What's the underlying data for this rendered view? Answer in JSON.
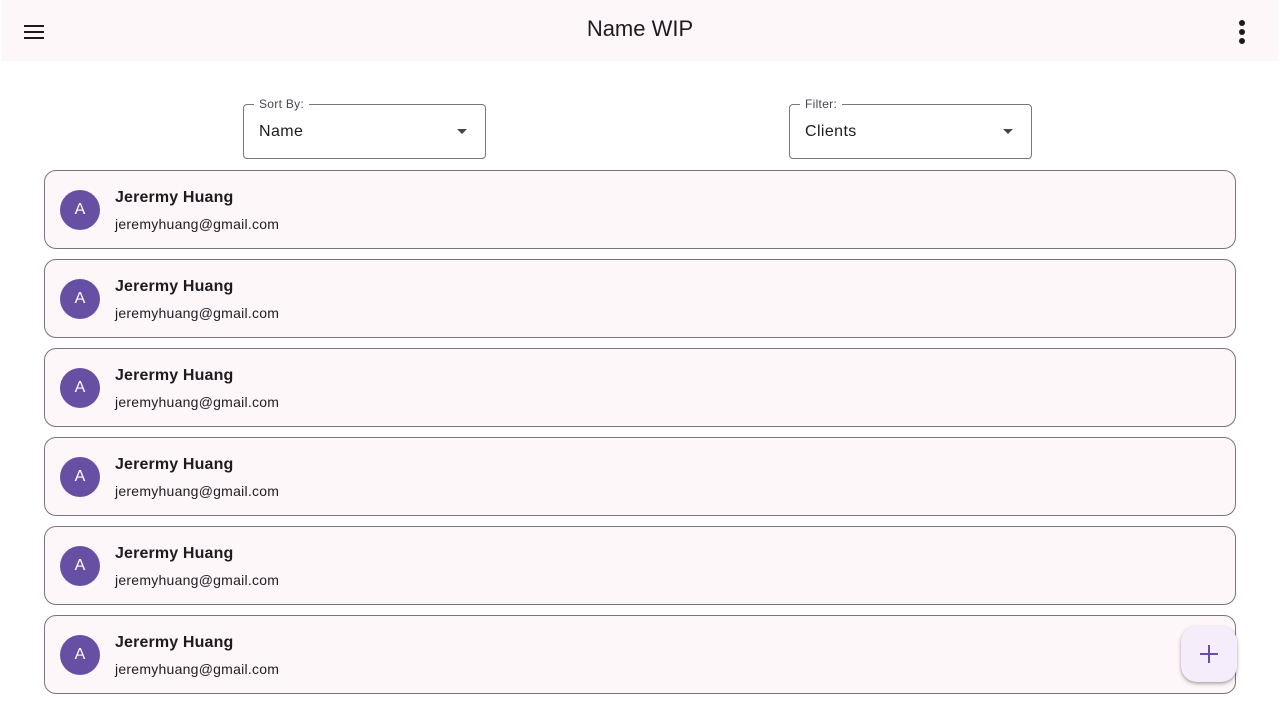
{
  "app_bar": {
    "title": "Name WIP",
    "menu_icon": "menu-icon",
    "more_icon": "more-vert-icon"
  },
  "sort": {
    "label": "Sort By:",
    "value": "Name"
  },
  "filter": {
    "label": "Filter:",
    "value": "Clients"
  },
  "contacts": [
    {
      "initial": "A",
      "name": "Jerermy Huang",
      "email": "jeremyhuang@gmail.com"
    },
    {
      "initial": "A",
      "name": "Jerermy Huang",
      "email": "jeremyhuang@gmail.com"
    },
    {
      "initial": "A",
      "name": "Jerermy Huang",
      "email": "jeremyhuang@gmail.com"
    },
    {
      "initial": "A",
      "name": "Jerermy Huang",
      "email": "jeremyhuang@gmail.com"
    },
    {
      "initial": "A",
      "name": "Jerermy Huang",
      "email": "jeremyhuang@gmail.com"
    },
    {
      "initial": "A",
      "name": "Jerermy Huang",
      "email": "jeremyhuang@gmail.com"
    }
  ],
  "fab": {
    "icon": "add-icon"
  },
  "colors": {
    "primary": "#6750a4",
    "surface": "#fef7f9",
    "outline": "#79747e"
  }
}
